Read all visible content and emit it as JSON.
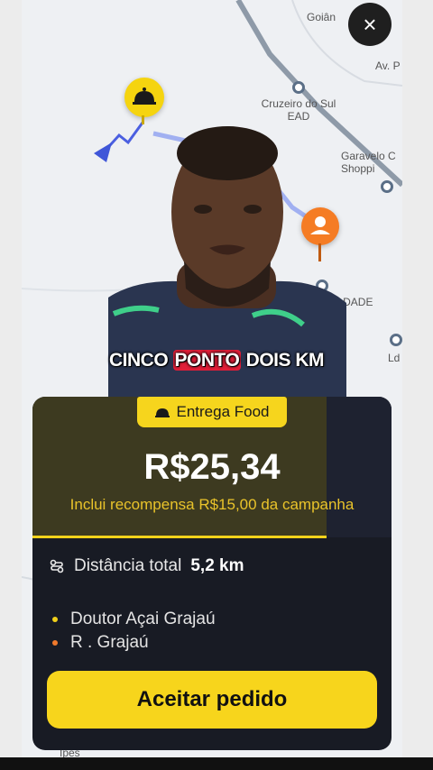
{
  "map": {
    "labels": {
      "goiania": "Goiân",
      "av": "Av. P",
      "cruzeiro": "Cruzeiro do Sul\nEAD",
      "garavelo": "Garavelo C\nShoppi",
      "fasul": "FASUL FACULDADE\nEAD",
      "ld": "Ld",
      "ipes": "Ipês"
    }
  },
  "close_icon": "×",
  "caption": {
    "word1": "CINCO",
    "word2": "PONTO",
    "word3": "DOIS KM"
  },
  "offer": {
    "badge_label": "Entrega Food",
    "price": "R$25,34",
    "reward_text": "Inclui recompensa R$15,00 da campanha",
    "distance_label": "Distância total",
    "distance_value": "5,2 km",
    "stops": [
      {
        "name": "Doutor Açai Grajaú",
        "color": "#f0d01a"
      },
      {
        "name": "R . Grajaú",
        "color": "#f07a2c"
      }
    ],
    "accept_label": "Aceitar pedido"
  },
  "colors": {
    "accent_yellow": "#f6d51d",
    "card_bg": "#181b24",
    "user_pin": "#f57c24"
  }
}
